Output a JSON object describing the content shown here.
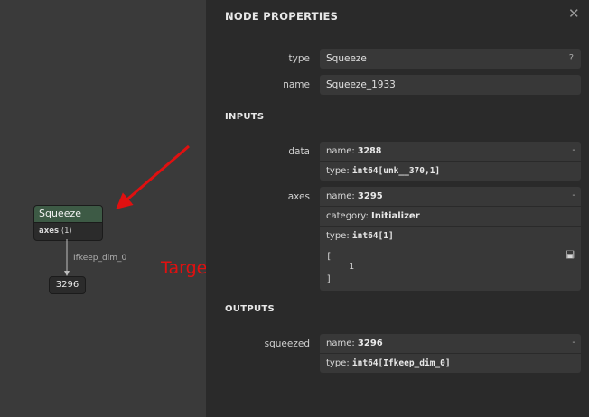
{
  "graph": {
    "node": {
      "title": "Squeeze",
      "attr_name": "axes",
      "attr_value": "⟨1⟩"
    },
    "edge_label": "Ifkeep_dim_0",
    "output_node": "3296",
    "annotation": "Target"
  },
  "panel": {
    "title": "NODE PROPERTIES",
    "close": "✕",
    "type_label": "type",
    "type_value": "Squeeze",
    "type_help": "?",
    "name_label": "name",
    "name_value": "Squeeze_1933",
    "inputs_title": "INPUTS",
    "inputs": [
      {
        "label": "data",
        "name_key": "name:",
        "name_value": "3288",
        "type_key": "type:",
        "type_value": "int64[unk__370,1]",
        "toggle": "-"
      },
      {
        "label": "axes",
        "name_key": "name:",
        "name_value": "3295",
        "category_key": "category:",
        "category_value": "Initializer",
        "type_key": "type:",
        "type_value": "int64[1]",
        "toggle": "-",
        "tensor_open": "[",
        "tensor_value": "1",
        "tensor_close": "]"
      }
    ],
    "outputs_title": "OUTPUTS",
    "outputs": [
      {
        "label": "squeezed",
        "name_key": "name:",
        "name_value": "3296",
        "type_key": "type:",
        "type_value": "int64[Ifkeep_dim_0]",
        "toggle": "-"
      }
    ]
  },
  "colors": {
    "annotation": "#e01010",
    "node_header": "#3d5a45",
    "panel_bg": "#2a2a2a",
    "canvas_bg": "#3a3a3a"
  }
}
